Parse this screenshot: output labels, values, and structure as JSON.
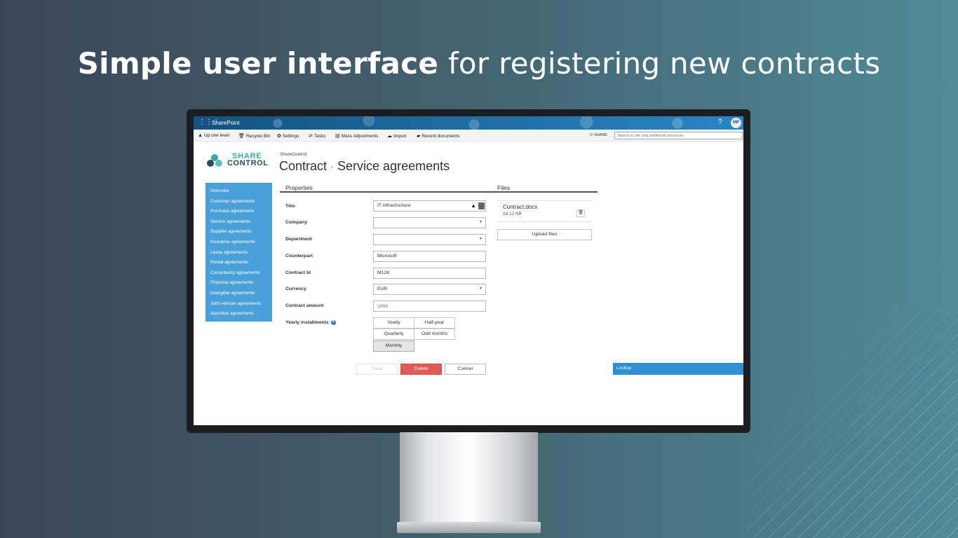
{
  "headline": {
    "strong": "Simple user interface",
    "light": " for registering new contracts"
  },
  "suitebar": {
    "brand": "SharePoint",
    "help": "?",
    "avatar": "MP"
  },
  "commands": [
    {
      "icon": "▲",
      "label": "Up one level"
    },
    {
      "icon": "🗑",
      "label": "Recycle Bin"
    },
    {
      "icon": "✿",
      "label": "Settings"
    },
    {
      "icon": "⇄",
      "label": "Tasks"
    },
    {
      "icon": "▤",
      "label": "Mass Adjustments"
    },
    {
      "icon": "☁",
      "label": "Import"
    },
    {
      "icon": "▰",
      "label": "Recent documents"
    }
  ],
  "share_label": "SHARE",
  "search": {
    "placeholder": "Search in site and additional resources"
  },
  "logo": {
    "line1": "SHARE",
    "line2": "CONTROL"
  },
  "header": {
    "site": "ShareControl",
    "title": "Contract",
    "subtitle": "Service agreements"
  },
  "sidebar": {
    "items": [
      "Overview",
      "Customer agreements",
      "Purchase agreements",
      "Service agreements",
      "Supplier agreements",
      "Insurance agreements",
      "Lease agreements",
      "Rental agreements",
      "Consultancy agreements",
      "Financial agreements",
      "Intangible agreements",
      "Joint venture agreements",
      "Aquistion agreements"
    ]
  },
  "properties": {
    "heading": "Properties",
    "fields": {
      "title": {
        "label": "Title",
        "value": "IT infrastructure"
      },
      "company": {
        "label": "Company",
        "value": ""
      },
      "department": {
        "label": "Department",
        "value": ""
      },
      "counterpart": {
        "label": "Counterpart",
        "value": "Microsoft"
      },
      "contract_id": {
        "label": "Contract Id",
        "value": "M12K"
      },
      "currency": {
        "label": "Currency",
        "value": "EUR"
      },
      "contract_amount": {
        "label": "Contract amount",
        "value": "",
        "placeholder": "1000"
      }
    },
    "installments": {
      "label": "Yearly installments",
      "options": [
        "Yearly",
        "Half-year",
        "Quarterly",
        "Odd months",
        "Monthly"
      ],
      "selected": "Monthly"
    }
  },
  "buttons": {
    "save": "Save",
    "delete": "Delete",
    "cancel": "Cancel"
  },
  "files": {
    "heading": "Files",
    "items": [
      {
        "name": "Contract.docx",
        "size": "18.12 KB"
      }
    ],
    "upload_label": "Upload files"
  },
  "lookup": {
    "label": "Lookup"
  }
}
